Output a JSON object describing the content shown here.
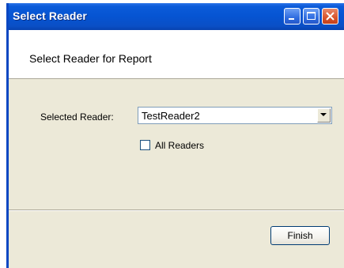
{
  "window": {
    "title": "Select Reader"
  },
  "header": {
    "title": "Select Reader for Report"
  },
  "form": {
    "reader_label": "Selected Reader:",
    "reader_value": "TestReader2",
    "all_readers_label": "All Readers",
    "all_readers_checked": false
  },
  "footer": {
    "finish_label": "Finish"
  },
  "colors": {
    "titlebar": "#0654d2",
    "panel": "#ece9d8",
    "header_bg": "#ffffff",
    "close_button": "#d9542c"
  },
  "icons": {
    "minimize": "minimize-icon",
    "maximize": "maximize-icon",
    "close": "close-icon",
    "dropdown": "chevron-down-icon"
  }
}
